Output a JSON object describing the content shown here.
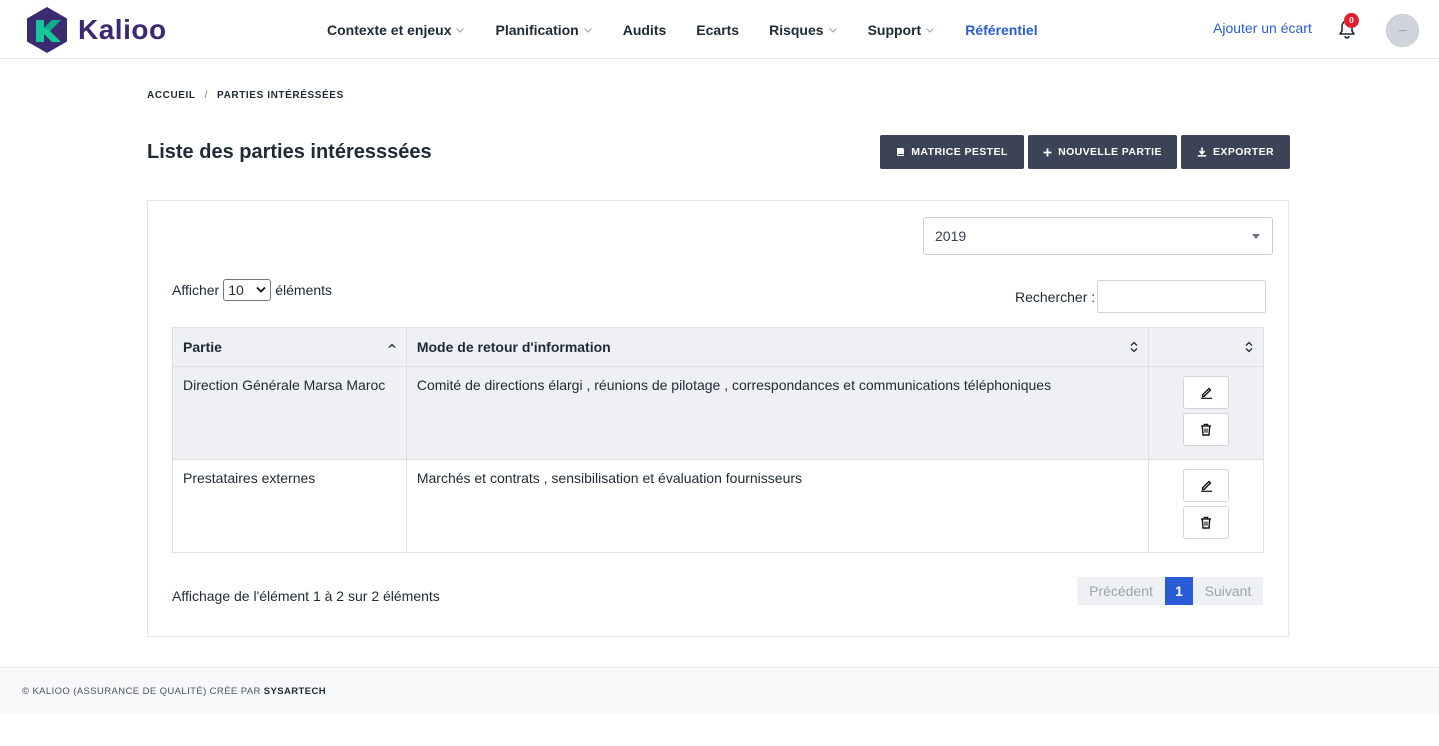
{
  "brand": {
    "name": "Kalioo",
    "accent": "#2a5bd7",
    "logo_color": "#3b2a72",
    "logo_green": "#16c79a"
  },
  "nav": {
    "items": [
      {
        "label": "Contexte et enjeux",
        "dropdown": true
      },
      {
        "label": "Planification",
        "dropdown": true
      },
      {
        "label": "Audits",
        "dropdown": false
      },
      {
        "label": "Ecarts",
        "dropdown": false
      },
      {
        "label": "Risques",
        "dropdown": true
      },
      {
        "label": "Support",
        "dropdown": true
      },
      {
        "label": "Référentiel",
        "dropdown": false,
        "active": true
      }
    ],
    "add_gap_link": "Ajouter un écart",
    "notification_count": "0",
    "avatar_text": "—"
  },
  "breadcrumb": {
    "home": "ACCUEIL",
    "separator": "/",
    "current": "PARTIES INTÉRÉSSÉES"
  },
  "page": {
    "title": "Liste des parties intéresssées",
    "actions": [
      {
        "label": "MATRICE PESTEL",
        "icon": "book-icon"
      },
      {
        "label": "NOUVELLE PARTIE",
        "icon": "plus-icon"
      },
      {
        "label": "EXPORTER",
        "icon": "download-icon"
      }
    ]
  },
  "filter": {
    "year": "2019"
  },
  "table_controls": {
    "show_prefix": "Afficher",
    "page_length": "10",
    "show_suffix": "éléments",
    "search_label": "Rechercher :",
    "search_value": ""
  },
  "table": {
    "columns": [
      "Partie",
      "Mode de retour d'information",
      ""
    ],
    "rows": [
      {
        "partie": "Direction Générale Marsa Maroc",
        "mode": "Comité de directions élargi , réunions de pilotage , correspondances et communications téléphoniques"
      },
      {
        "partie": "Prestataires externes",
        "mode": "Marchés et contrats , sensibilisation et évaluation fournisseurs"
      }
    ]
  },
  "pagination": {
    "info": "Affichage de l'élément 1 à 2 sur 2 éléments",
    "previous": "Précédent",
    "current_page": "1",
    "next": "Suivant"
  },
  "footer": {
    "text": "© KALIOO (ASSURANCE DE QUALITÉ) CRÉE PAR",
    "author": "SYSARTECH"
  }
}
